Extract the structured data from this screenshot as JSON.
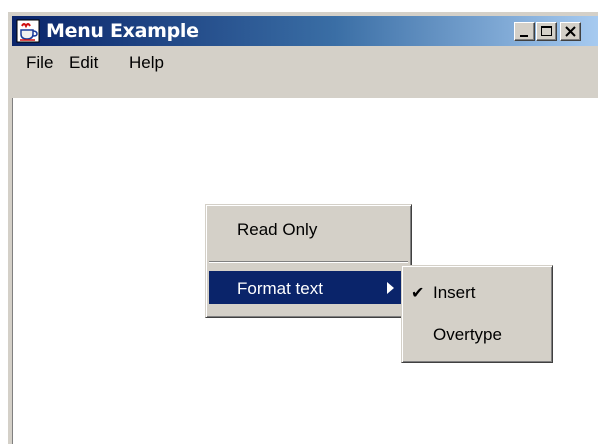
{
  "window": {
    "title": "Menu Example",
    "icon": "java-cup-icon",
    "controls": [
      "minimize-icon",
      "maximize-icon",
      "close-icon"
    ]
  },
  "menubar": {
    "items": [
      "File",
      "Edit",
      "Help"
    ]
  },
  "popup_menu": {
    "items": [
      {
        "label": "Read Only"
      },
      {
        "label": "Format text",
        "submenu": true,
        "selected": true
      }
    ]
  },
  "submenu": {
    "items": [
      {
        "label": "Insert",
        "checked": true,
        "check_icon": "check-icon"
      },
      {
        "label": "Overtype",
        "checked": false
      }
    ]
  },
  "colors": {
    "title_start": "#0a246a",
    "title_end": "#a6caf0",
    "highlight": "#0a246a",
    "face": "#d4d0c8"
  }
}
